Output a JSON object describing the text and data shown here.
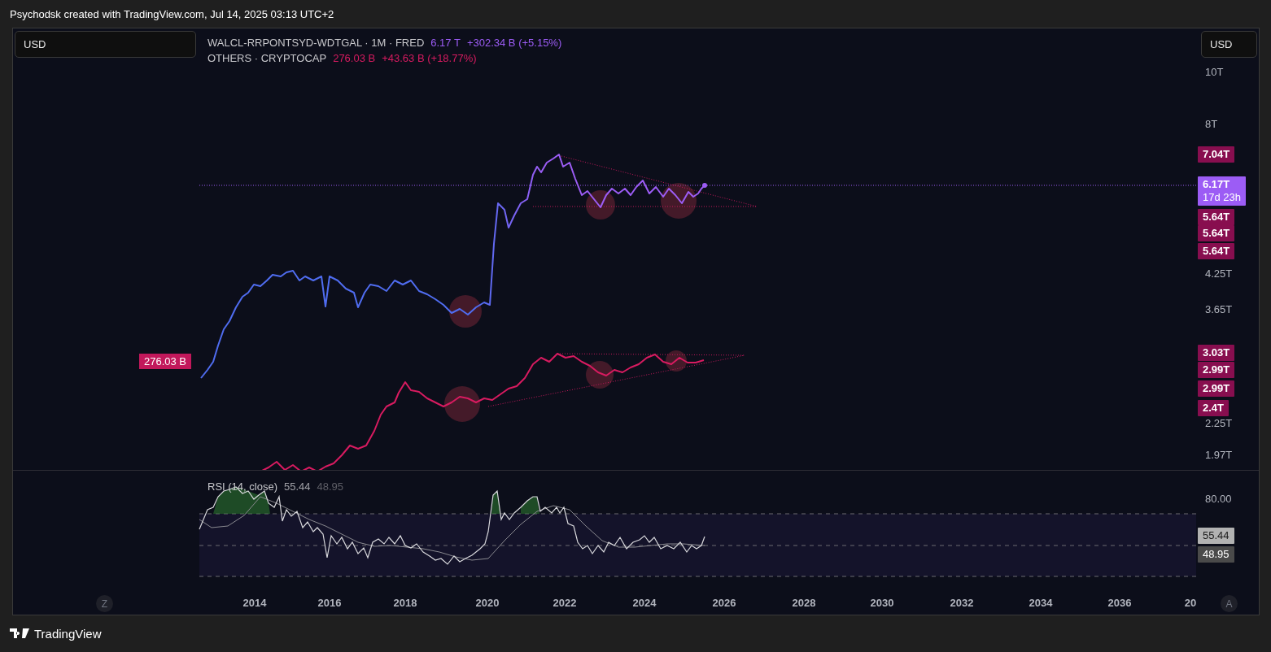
{
  "header": {
    "caption": "Psychodsk created with TradingView.com, Jul 14, 2025 03:13 UTC+2"
  },
  "currency_buttons": [
    {
      "label": "USD"
    },
    {
      "label": "USD"
    }
  ],
  "legend": [
    {
      "symbol": "WALCL-RRPONTSYD-WDTGAL · 1M · FRED",
      "value": "6.17 T",
      "change": "+302.34 B (+5.15%)",
      "color": "#9c5cf5"
    },
    {
      "symbol": "OTHERS · CRYPTOCAP",
      "value": "276.03 B",
      "change": "+43.63 B (+18.77%)",
      "color": "#d81b60"
    }
  ],
  "left_label": "276.03 B",
  "price_axis": {
    "ticks": [
      "10T",
      "8T",
      "4.25T",
      "3.65T",
      "2.25T",
      "1.97T"
    ],
    "labels": [
      {
        "text": "7.04T",
        "kind": "level"
      },
      {
        "text": "6.17T",
        "sub": "17d 23h",
        "kind": "last"
      },
      {
        "text": "5.64T",
        "kind": "level"
      },
      {
        "text": "5.64T",
        "kind": "level"
      },
      {
        "text": "5.64T",
        "kind": "level"
      },
      {
        "text": "3.03T",
        "kind": "level"
      },
      {
        "text": "2.99T",
        "kind": "level"
      },
      {
        "text": "2.99T",
        "kind": "level"
      },
      {
        "text": "2.4T",
        "kind": "level"
      }
    ]
  },
  "rsi": {
    "title": "RSI (14, close)",
    "value": "55.44",
    "signal": "48.95",
    "ticks": [
      "80.00"
    ],
    "labels": [
      {
        "text": "55.44",
        "kind": "rsi"
      },
      {
        "text": "48.95",
        "kind": "average"
      }
    ]
  },
  "time_axis": {
    "labels": [
      "2014",
      "2016",
      "2018",
      "2020",
      "2022",
      "2024",
      "2026",
      "2028",
      "2030",
      "2032",
      "2034",
      "2036",
      "20"
    ],
    "left_button": "Z",
    "right_button": "A"
  },
  "footer": {
    "brand": "TradingView"
  }
}
